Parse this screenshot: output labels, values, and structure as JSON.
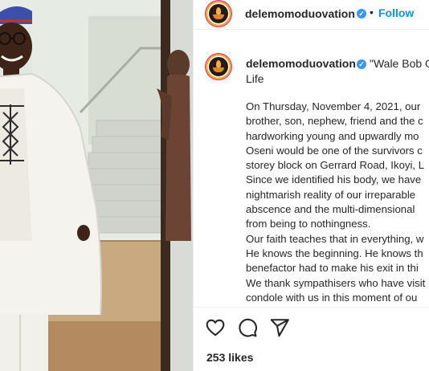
{
  "photo": {
    "description_icon": "man-in-white-agbada-photo"
  },
  "post": {
    "username": "delemomoduovation",
    "dot": "•",
    "follow_label": "Follow",
    "verified_icon": "✓",
    "title_quote": "\"Wale Bob O",
    "title_continuation": "Life",
    "body_lines": [
      "On Thursday, November 4, 2021, our",
      "brother, son, nephew, friend and the c",
      "hardworking young and upwardly mo",
      "Oseni would be one of the survivors c",
      "storey block on Gerrard Road, Ikoyi, L",
      "Since we identified his body, we have",
      "nightmarish reality of our irreparable",
      "abscence and the multi-dimensional",
      "from being to nothingness.",
      "Our faith teaches that in everything, w",
      "He knows the beginning. He knows th",
      "benefactor had to make his exit in thi",
      "We thank sympathisers who have visit",
      "condole with us in this moment of ou"
    ],
    "likes": "253 likes"
  },
  "icons": {
    "like": "heart-icon",
    "comment": "comment-icon",
    "share": "share-icon"
  },
  "colors": {
    "link_blue": "#0095f6",
    "verified_blue": "#3897f0",
    "text": "#262626",
    "divider": "#efefef"
  }
}
